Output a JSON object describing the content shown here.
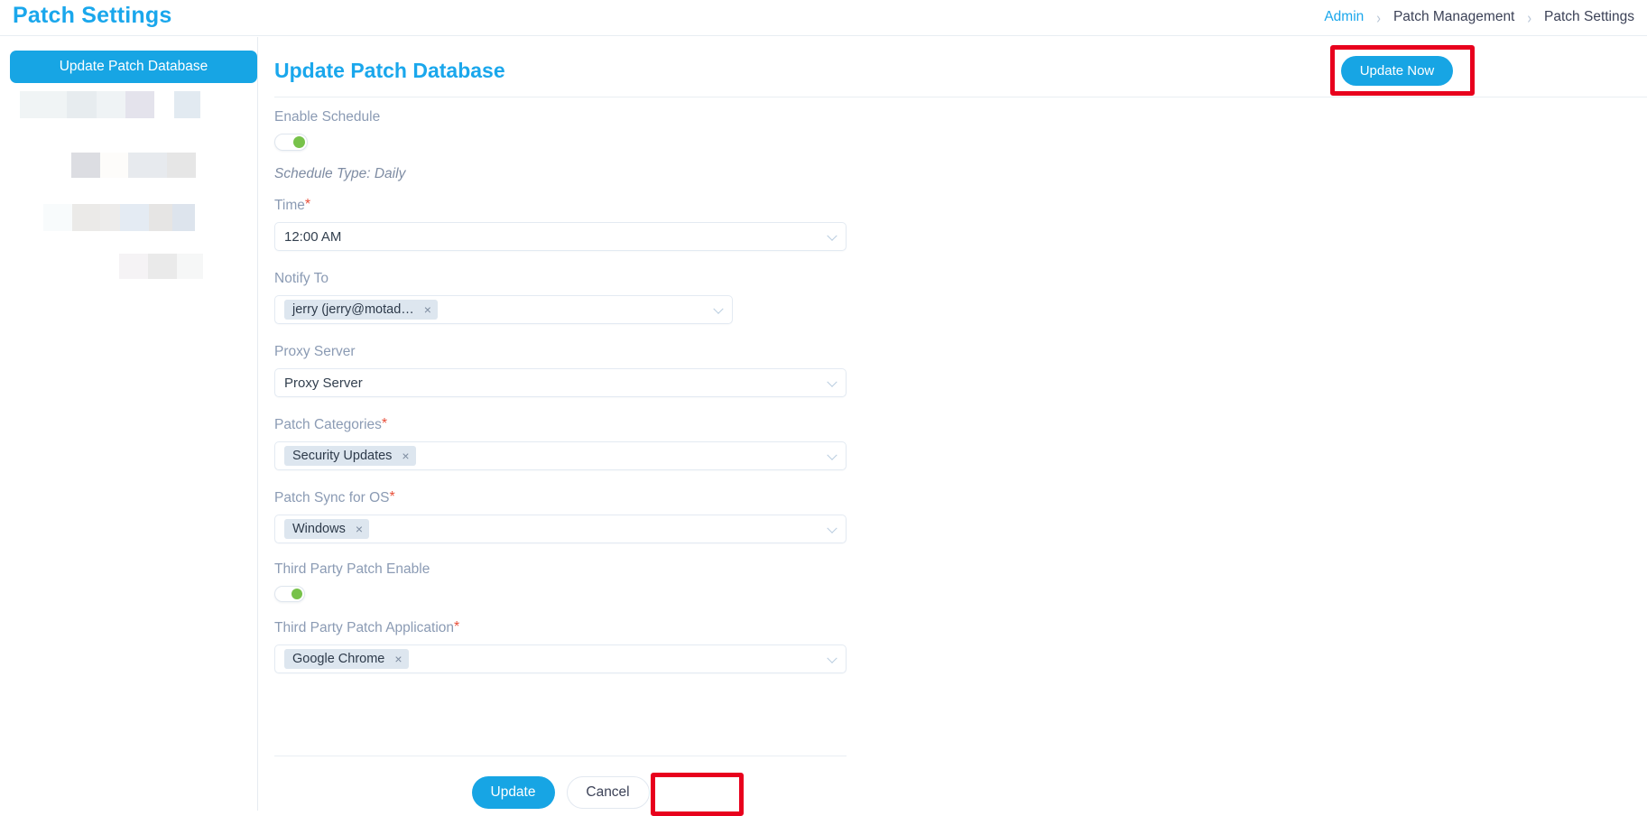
{
  "header": {
    "page_title": "Patch Settings",
    "breadcrumb": [
      {
        "label": "Admin",
        "is_link": true
      },
      {
        "label": "Patch Management",
        "is_link": false
      },
      {
        "label": "Patch Settings",
        "is_link": false
      }
    ],
    "separator": "›"
  },
  "sidebar": {
    "primary_button": "Update Patch Database",
    "redacted_items_note": "blurred placeholder rows"
  },
  "main": {
    "title": "Update Patch Database",
    "update_now_button": "Update Now",
    "form": {
      "enable_schedule": {
        "label": "Enable Schedule",
        "state": "on"
      },
      "schedule_type": "Schedule Type: Daily",
      "time": {
        "label": "Time",
        "required": "*",
        "value": "12:00 AM"
      },
      "notify_to": {
        "label": "Notify To",
        "required": "",
        "chip": "jerry (jerry@motad…",
        "chip_remove": "×"
      },
      "proxy_server": {
        "label": "Proxy Server",
        "required": "",
        "value": "Proxy Server"
      },
      "patch_categories": {
        "label": "Patch Categories",
        "required": "*",
        "chip": "Security Updates",
        "chip_remove": "×"
      },
      "patch_sync_os": {
        "label": "Patch Sync for OS",
        "required": "*",
        "chip": "Windows",
        "chip_remove": "×"
      },
      "third_party_enable": {
        "label": "Third Party Patch Enable",
        "state": "on"
      },
      "third_party_application": {
        "label": "Third Party Patch Application",
        "required": "*",
        "chip": "Google Chrome",
        "chip_remove": "×"
      }
    },
    "footer": {
      "update_button": "Update",
      "cancel_button": "Cancel"
    }
  },
  "colors": {
    "accent_blue": "#17a5e4",
    "title_blue": "#1aa7ec",
    "toggle_green": "#77c24a",
    "required_red": "#e8503a",
    "annotation_red": "#e8001d",
    "label_gray": "#8b9bb4",
    "chip_bg": "#dde6ef"
  }
}
